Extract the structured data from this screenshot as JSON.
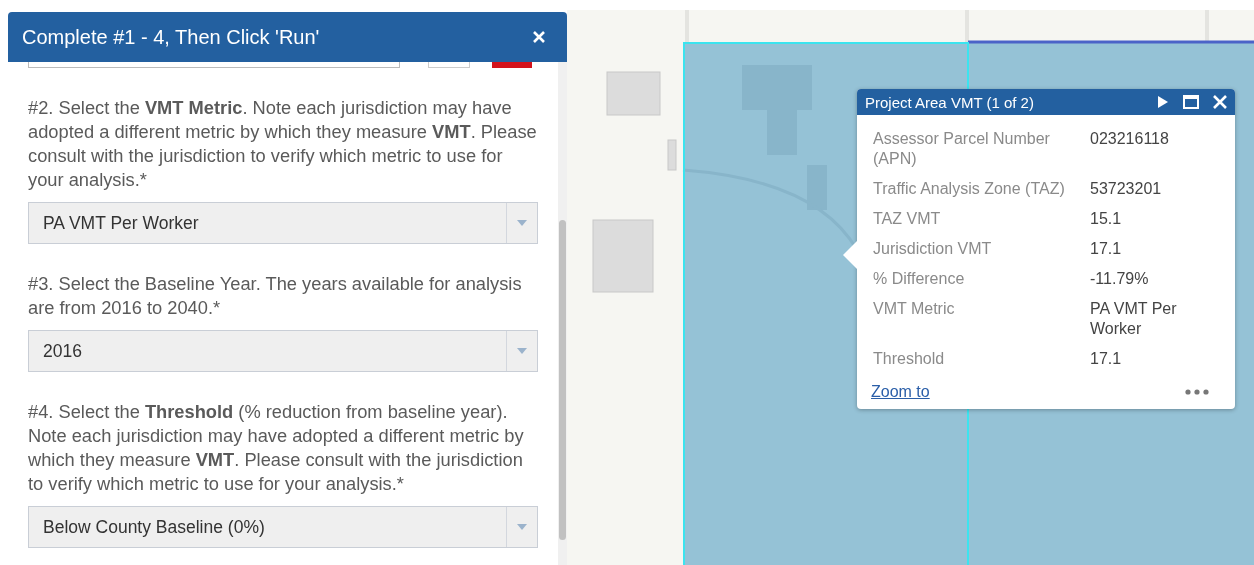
{
  "panel": {
    "title": "Complete #1 - 4, Then Click 'Run'",
    "steps": [
      {
        "text": "#2. Select the **VMT Metric**. Note each jurisdiction may have adopted a different metric by which they measure **VMT**. Please consult with the jurisdiction to verify which metric to use for your analysis.*",
        "value": "PA VMT Per Worker"
      },
      {
        "text": "#3. Select the Baseline Year. The years available for analysis are from 2016 to 2040.*",
        "value": "2016"
      },
      {
        "text": "#4. Select the **Threshold** (% reduction from baseline year). Note each jurisdiction may have adopted a different metric by which they measure **VMT**. Please consult with the jurisdiction to verify which metric to use for your analysis.*",
        "value": "Below County Baseline (0%)"
      }
    ]
  },
  "popup": {
    "title": "Project Area VMT (1 of 2)",
    "fields": [
      {
        "label": "Assessor Parcel Number (APN)",
        "value": "023216118"
      },
      {
        "label": "Traffic Analysis Zone (TAZ)",
        "value": "53723201"
      },
      {
        "label": "TAZ VMT",
        "value": "15.1"
      },
      {
        "label": "Jurisdiction VMT",
        "value": "17.1"
      },
      {
        "label": "% Difference",
        "value": "-11.79%"
      },
      {
        "label": "VMT Metric",
        "value": "PA VMT Per Worker"
      },
      {
        "label": "Threshold",
        "value": "17.1"
      }
    ],
    "link": "Zoom to"
  }
}
